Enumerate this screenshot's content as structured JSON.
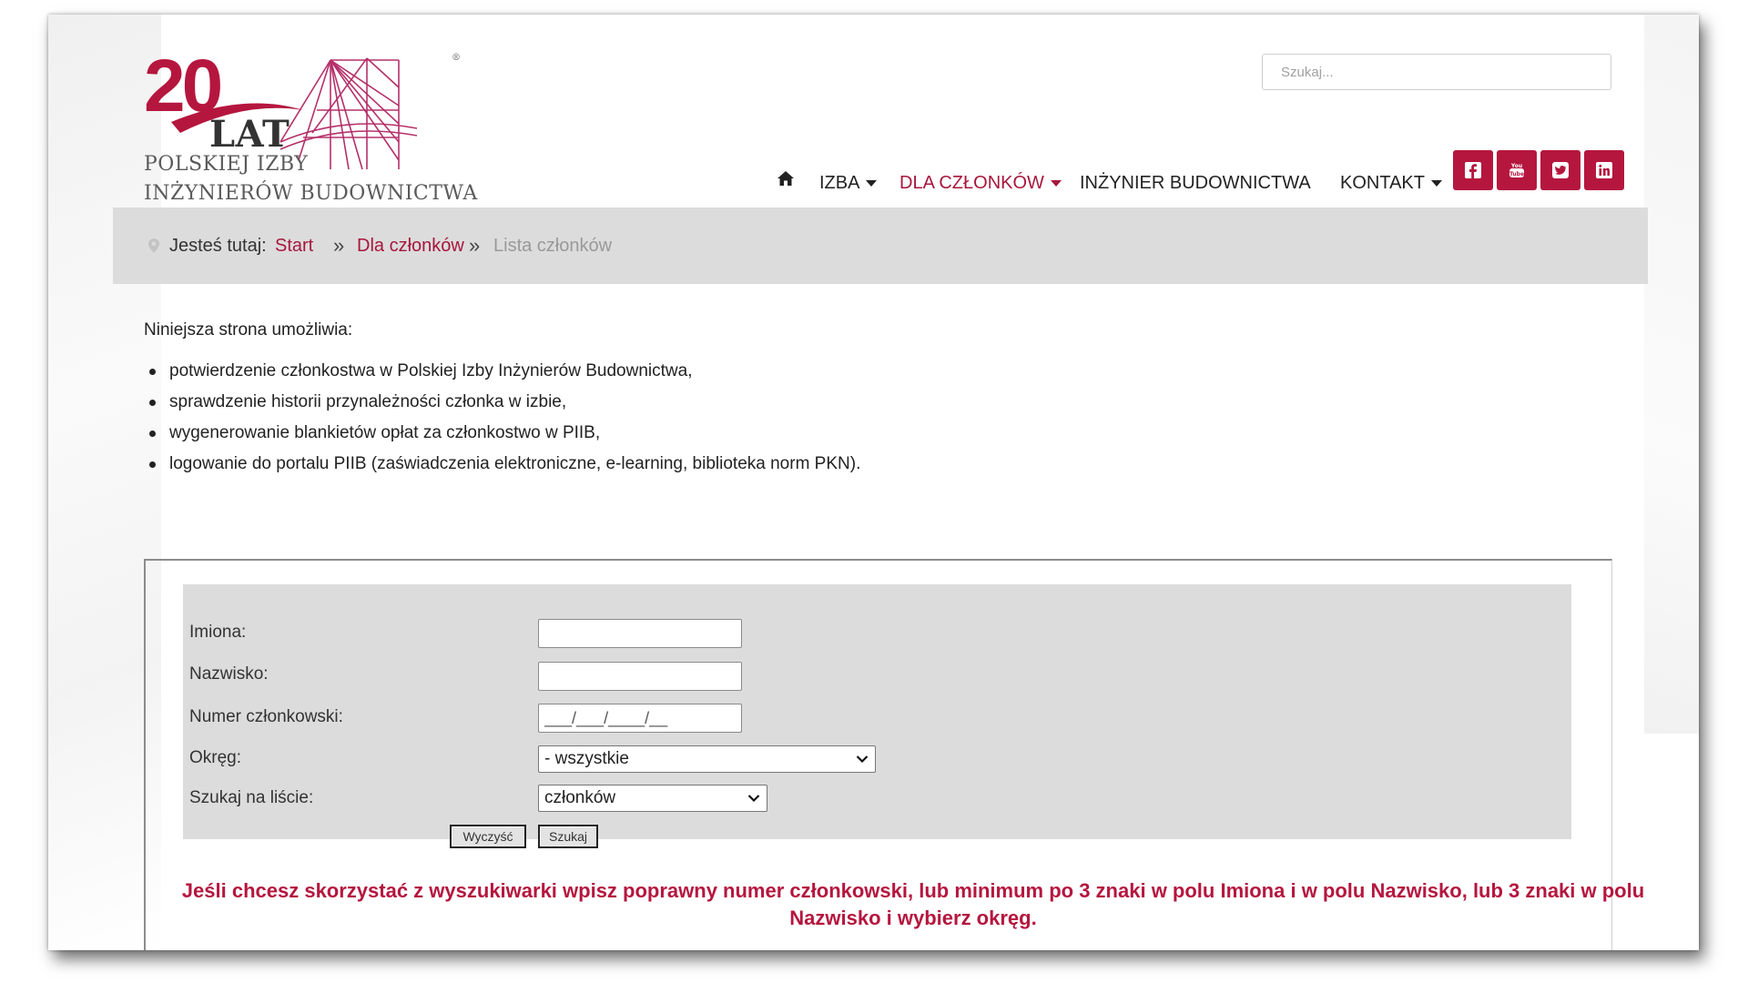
{
  "logo": {
    "number": "20",
    "lat": "LAT",
    "line1": "POLSKIEJ IZBY",
    "line2": "INŻYNIERÓW BUDOWNICTWA",
    "registered": "®"
  },
  "search": {
    "placeholder": "Szukaj..."
  },
  "nav": {
    "items": [
      {
        "label": "IZBA",
        "has_dropdown": true,
        "active": false
      },
      {
        "label": "DLA CZŁONKÓW",
        "has_dropdown": true,
        "active": true
      },
      {
        "label": "INŻYNIER BUDOWNICTWA",
        "has_dropdown": false,
        "active": false
      },
      {
        "label": "KONTAKT",
        "has_dropdown": true,
        "active": false
      }
    ],
    "home_icon": "home-icon",
    "social": [
      "facebook-icon",
      "youtube-icon",
      "twitter-icon",
      "linkedin-icon"
    ],
    "social_color": "#b5163e",
    "accent_color": "#a8163c"
  },
  "breadcrumb": {
    "label": "Jesteś tutaj:",
    "items": [
      "Start",
      "Dla członków",
      "Lista członków"
    ],
    "separator": "»"
  },
  "intro": {
    "text": "Niniejsza strona umożliwia:",
    "bullets": [
      "potwierdzenie członkostwa w Polskiej Izby Inżynierów Budownictwa,",
      "sprawdzenie historii przynależności członka w izbie,",
      "wygenerowanie blankietów opłat za członkostwo w PIIB,",
      "logowanie do portalu PIIB (zaświadczenia elektroniczne, e-learning, biblioteka norm PKN)."
    ]
  },
  "form": {
    "fields": [
      {
        "label": "Imiona:",
        "value": ""
      },
      {
        "label": "Nazwisko:",
        "value": ""
      },
      {
        "label": "Numer członkowski:",
        "placeholder": "___/___/____/__"
      }
    ],
    "okreg": {
      "label": "Okręg:",
      "selected": "- wszystkie"
    },
    "lista": {
      "label": "Szukaj na liście:",
      "selected": "członków"
    },
    "clear_label": "Wyczyść",
    "search_label": "Szukaj"
  },
  "warning": "Jeśli chcesz skorzystać z wyszukiwarki wpisz poprawny numer członkowski, lub minimum po 3 znaki w polu Imiona i w polu Nazwisko, lub 3 znaki w polu Nazwisko i wybierz okręg."
}
